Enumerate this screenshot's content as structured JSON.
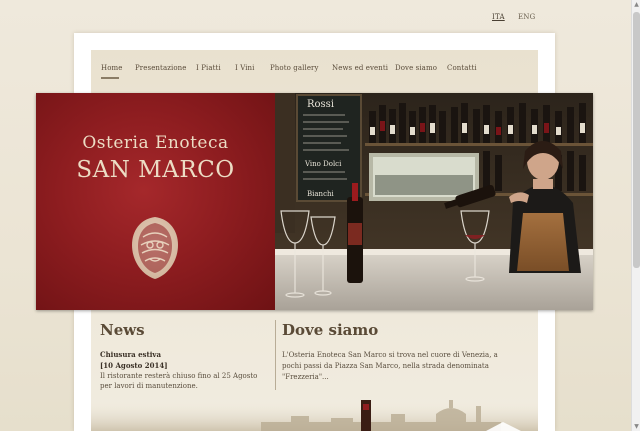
{
  "languages": [
    {
      "label": "ITA",
      "active": true
    },
    {
      "label": "ENG",
      "active": false
    }
  ],
  "nav": {
    "items": [
      {
        "label": "Home",
        "active": true
      },
      {
        "label": "Presentazione"
      },
      {
        "label": "I Piatti"
      },
      {
        "label": "I Vini"
      },
      {
        "label": "Photo gallery"
      },
      {
        "label": "News ed eventi"
      },
      {
        "label": "Dove siamo"
      },
      {
        "label": "Contatti"
      }
    ]
  },
  "banner": {
    "line1": "Osteria Enoteca",
    "line2": "SAN MARCO",
    "chalkboard": [
      "Rossi",
      "Vino Dolci",
      "Bianchi"
    ]
  },
  "news": {
    "heading": "News",
    "item_title": "Chiusura estiva",
    "item_date": "[10 Agosto 2014]",
    "item_text": "Il ristorante resterà chiuso fino al 25 Agosto per lavori di manutenzione."
  },
  "location": {
    "heading": "Dove siamo",
    "text": "L'Osteria Enoteca San Marco si trova nel cuore di Venezia, a pochi passi da Piazza San Marco, nella strada denominata \"Frezzeria\"..."
  },
  "colors": {
    "banner_red": "#8e1d20",
    "banner_text": "#ecdcc4",
    "background": "#efe9dc"
  }
}
